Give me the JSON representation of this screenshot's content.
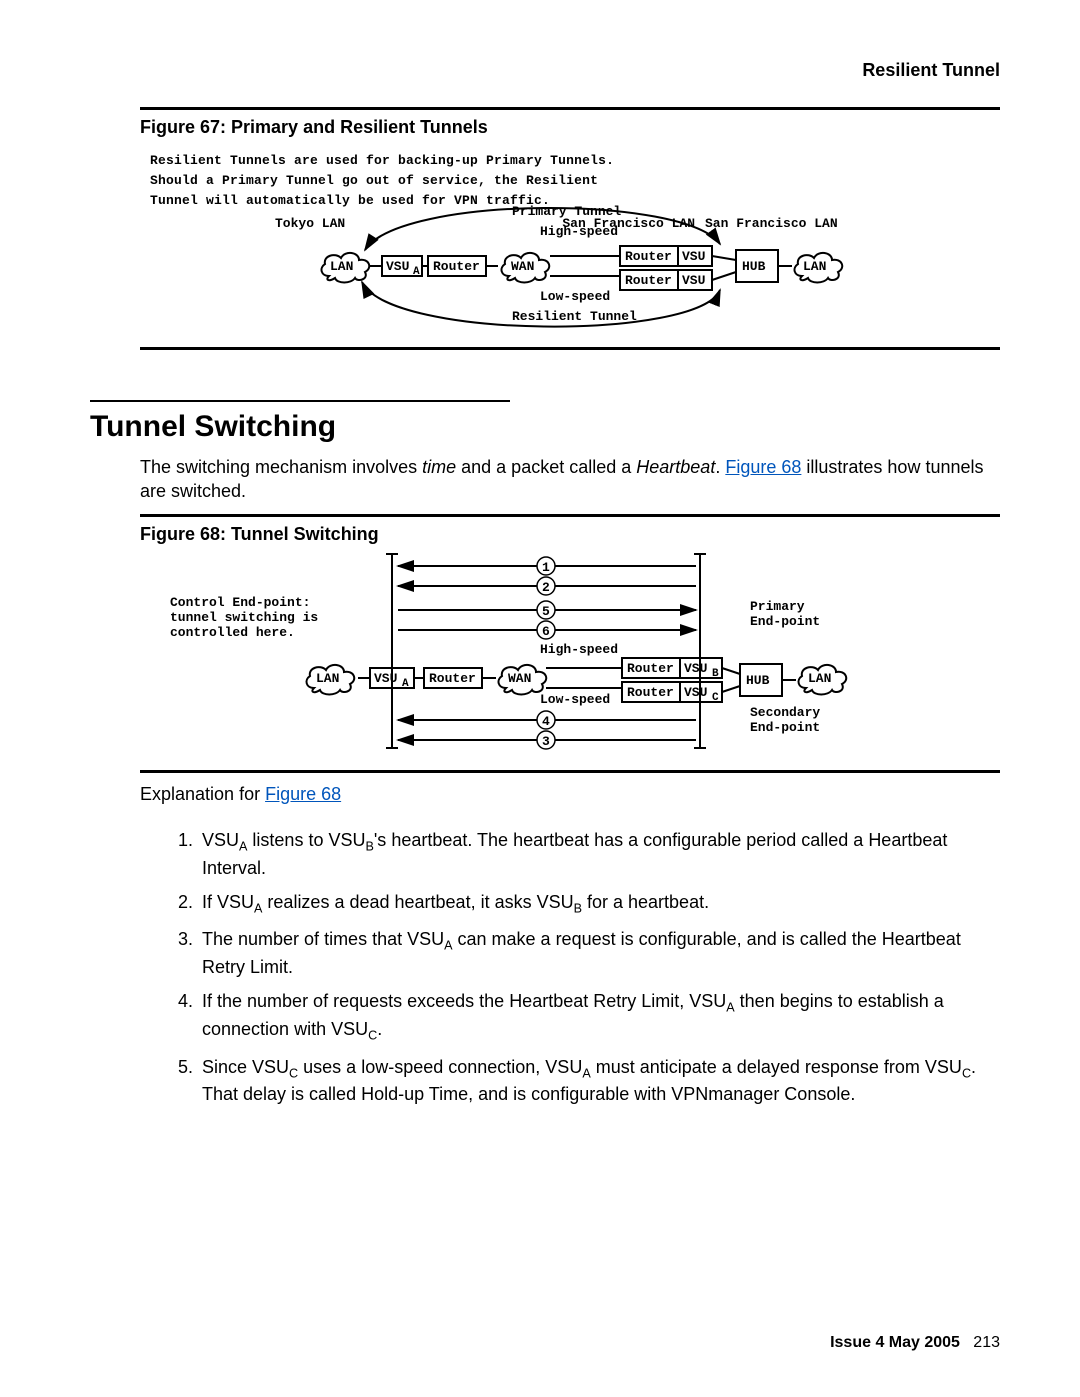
{
  "header": {
    "title": "Resilient Tunnel"
  },
  "fig67": {
    "caption": "Figure 67: Primary and Resilient Tunnels",
    "intro_l1": "Resilient Tunnels are used for backing-up Primary Tunnels.",
    "intro_l2": "Should a Primary Tunnel go out of service, the Resilient",
    "intro_l3": "Tunnel will automatically be used for VPN traffic.",
    "labels": {
      "tokyo": "Tokyo LAN",
      "sf": "San Francisco LAN",
      "lan": "LAN",
      "vsu_a": "VSU",
      "vsu_sub": "A",
      "router": "Router",
      "wan": "WAN",
      "primary": "Primary Tunnel",
      "resilient": "Resilient Tunnel",
      "hispeed": "High-speed",
      "lospeed": "Low-speed",
      "vsu": "VSU",
      "hub": "HUB"
    }
  },
  "section": {
    "h1": "Tunnel Switching"
  },
  "para1": {
    "t1": "The switching mechanism involves ",
    "i1": "time",
    "t2": " and a packet called a ",
    "i2": "Heartbeat",
    "t3": ". ",
    "link": "Figure 68",
    "t4": " illustrates how tunnels are switched."
  },
  "fig68": {
    "caption": "Figure 68: Tunnel Switching",
    "labels": {
      "ctrl1": "Control End-point:",
      "ctrl2": "tunnel switching is",
      "ctrl3": "controlled here.",
      "primary1": "Primary",
      "primary2": "End-point",
      "secondary1": "Secondary",
      "secondary2": "End-point",
      "hispeed": "High-speed",
      "lospeed": "Low-speed",
      "lan": "LAN",
      "vsu_a": "VSU",
      "vsu_a_sub": "A",
      "router": "Router",
      "wan": "WAN",
      "vsu_b": "VSU",
      "vsu_b_sub": "B",
      "vsu_c": "VSU",
      "vsu_c_sub": "C",
      "hub": "HUB",
      "n1": "1",
      "n2": "2",
      "n3": "3",
      "n4": "4",
      "n5": "5",
      "n6": "6"
    }
  },
  "expl_label": {
    "t1": "Explanation for ",
    "link": "Figure 68"
  },
  "list": {
    "i1": {
      "a": "VSU",
      "as": "A",
      "b": " listens to VSU",
      "bs": "B",
      "c": "'s heartbeat. The heartbeat has a configurable period called a ",
      "it": "Heartbeat Interval",
      "d": "."
    },
    "i2": {
      "a": "If VSU",
      "as": "A",
      "b": " realizes a dead heartbeat, it asks VSU",
      "bs": "B",
      "c": " for a heartbeat."
    },
    "i3": {
      "a": "The number of times that VSU",
      "as": "A",
      "b": " can make a request is configurable, and is called the ",
      "it": "Heartbeat Retry Limit",
      "c": "."
    },
    "i4": {
      "a": "If the number of requests exceeds the ",
      "it": "Heartbeat Retry Limit",
      "b": ", VSU",
      "bs": "A",
      "c": " then begins to establish a connection with VSU",
      "cs": "C",
      "d": "."
    },
    "i5": {
      "a": "Since VSU",
      "as": "C",
      "b": " uses a low-speed connection, VSU",
      "bs": "A",
      "c": " must anticipate a delayed response from VSU",
      "cs": "C",
      "d": ". That delay is called ",
      "it": "Hold-up Time",
      "e": ", and is configurable with VPNmanager Console."
    }
  },
  "footer": {
    "issue": "Issue 4   May 2005",
    "page": "213"
  }
}
